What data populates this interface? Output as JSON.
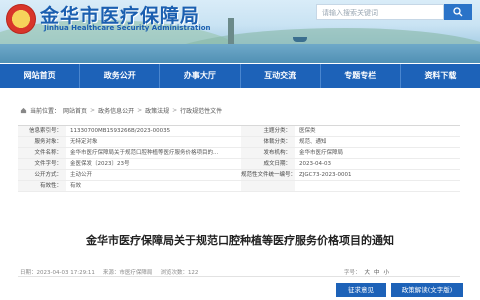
{
  "header": {
    "site_title": "金华市医疗保障局",
    "site_subtitle": "Jinhua Healthcare Security Administration",
    "search_placeholder": "请输入搜索关键词"
  },
  "nav": {
    "items": [
      "网站首页",
      "政务公开",
      "办事大厅",
      "互动交流",
      "专题专栏",
      "资料下载"
    ]
  },
  "breadcrumb": {
    "items": [
      "当前位置：",
      "网站首页",
      "政务信息公开",
      "政策法规",
      "行政规范性文件"
    ],
    "separator": ">"
  },
  "info_table": {
    "rows": [
      {
        "l1": "信息索引号：",
        "v1": "11330700MB1593266B/2023-00035",
        "l2": "主题分类：",
        "v2": "医保类"
      },
      {
        "l1": "服务对象：",
        "v1": "无特定对象",
        "l2": "体裁分类：",
        "v2": "规范、通知"
      },
      {
        "l1": "文件名称：",
        "v1": "金华市医疗保障局关于规范口腔种植等医疗服务价格项目的...",
        "l2": "发布机构：",
        "v2": "金华市医疗保障局"
      },
      {
        "l1": "文件字号：",
        "v1": "金医保发〔2023〕23号",
        "l2": "成文日期：",
        "v2": "2023-04-03"
      },
      {
        "l1": "公开方式：",
        "v1": "主动公开",
        "l2": "规范性文件统一编号：",
        "v2": "ZJGC73-2023-0001"
      },
      {
        "l1": "有效性：",
        "v1": "有效",
        "l2": "",
        "v2": ""
      }
    ]
  },
  "document": {
    "title": "金华市医疗保障局关于规范口腔种植等医疗服务价格项目的通知"
  },
  "meta": {
    "date": "日期：2023-04-03 17:29:11",
    "source": "来源：市医疗保障局",
    "views": "浏览次数：122"
  },
  "font_size": {
    "label": "字号：",
    "options": [
      "大",
      "中",
      "小"
    ]
  },
  "buttons": {
    "feedback": "征求意见",
    "interpret": "政策解读(文字版)"
  },
  "colors": {
    "nav_bg": "#1d62b8",
    "title_blue": "#1b5fb0",
    "button_bg": "#1d62b8"
  }
}
